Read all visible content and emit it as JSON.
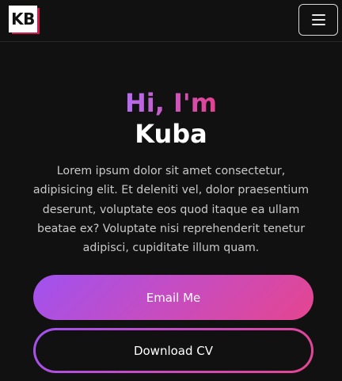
{
  "navbar": {
    "logo_text": "KB",
    "menu_icon": "hamburger-menu-icon"
  },
  "hero": {
    "greeting": "Hi, I'm",
    "name": "Kuba",
    "intro": "Lorem ipsum dolor sit amet consectetur, adipisicing elit. Et deleniti vel, dolor praesentium deserunt, voluptate eos quod itaque ea ullam beatae ex? Voluptate nisi reprehenderit tenetur adipisci, cupiditate illum quam."
  },
  "actions": {
    "email_label": "Email Me",
    "cv_label": "Download CV"
  },
  "colors": {
    "background": "#111111",
    "accent_start": "#a052f0",
    "accent_end": "#e5458f",
    "logo_frame": "#d4194a"
  }
}
